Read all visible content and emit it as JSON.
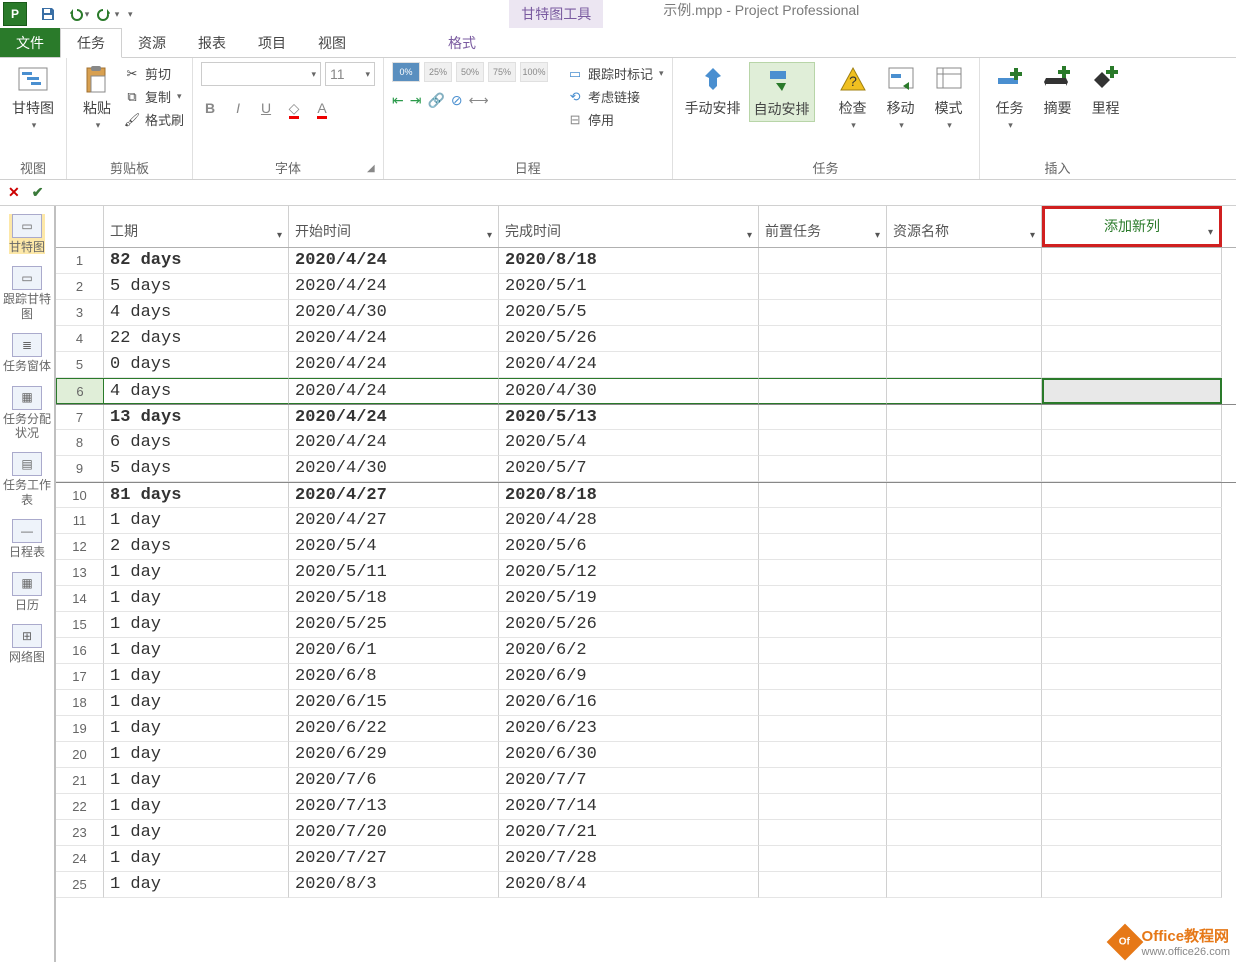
{
  "title": {
    "tool_context": "甘特图工具",
    "doc": "示例.mpp - Project Professional"
  },
  "tabs": {
    "file": "文件",
    "task": "任务",
    "resource": "资源",
    "report": "报表",
    "project": "项目",
    "view": "视图",
    "format": "格式"
  },
  "ribbon": {
    "view_group": "视图",
    "gantt_btn": "甘特图",
    "clipboard": {
      "label": "剪贴板",
      "paste": "粘贴",
      "cut": "剪切",
      "copy": "复制",
      "painter": "格式刷"
    },
    "font": {
      "label": "字体",
      "size": "11",
      "bold": "B",
      "italic": "I",
      "underline": "U"
    },
    "schedule": {
      "label": "日程",
      "p0": "0%",
      "p25": "25%",
      "p50": "50%",
      "p75": "75%",
      "p100": "100%",
      "track_mark": "跟踪时标记",
      "consider_link": "考虑链接",
      "deactivate": "停用"
    },
    "tasks": {
      "label": "任务",
      "manual": "手动安排",
      "auto": "自动安排",
      "inspect": "检查",
      "move": "移动",
      "mode": "模式"
    },
    "insert": {
      "label": "插入",
      "task": "任务",
      "summary": "摘要",
      "milestone": "里程"
    }
  },
  "side_views": {
    "gantt": "甘特图",
    "tracking": "跟踪甘特图",
    "task_form": "任务窗体",
    "usage": "任务分配状况",
    "task_sheet": "任务工作表",
    "timeline": "日程表",
    "calendar": "日历",
    "network": "网络图"
  },
  "columns": {
    "duration": "工期",
    "start": "开始时间",
    "finish": "完成时间",
    "predecessors": "前置任务",
    "resources": "资源名称",
    "new": "添加新列"
  },
  "rows": [
    {
      "n": 1,
      "dur": "82 days",
      "start": "2020/4/24",
      "end": "2020/8/18",
      "bold": true
    },
    {
      "n": 2,
      "dur": "5 days",
      "start": "2020/4/24",
      "end": "2020/5/1"
    },
    {
      "n": 3,
      "dur": "4 days",
      "start": "2020/4/30",
      "end": "2020/5/5"
    },
    {
      "n": 4,
      "dur": "22 days",
      "start": "2020/4/24",
      "end": "2020/5/26"
    },
    {
      "n": 5,
      "dur": "0 days",
      "start": "2020/4/24",
      "end": "2020/4/24"
    },
    {
      "n": 6,
      "dur": "4 days",
      "start": "2020/4/24",
      "end": "2020/4/30",
      "sel": true
    },
    {
      "n": 7,
      "dur": "13 days",
      "start": "2020/4/24",
      "end": "2020/5/13",
      "bold": true
    },
    {
      "n": 8,
      "dur": "6 days",
      "start": "2020/4/24",
      "end": "2020/5/4"
    },
    {
      "n": 9,
      "dur": "5 days",
      "start": "2020/4/30",
      "end": "2020/5/7"
    },
    {
      "n": 10,
      "dur": "81 days",
      "start": "2020/4/27",
      "end": "2020/8/18",
      "bold": true
    },
    {
      "n": 11,
      "dur": "1 day",
      "start": "2020/4/27",
      "end": "2020/4/28"
    },
    {
      "n": 12,
      "dur": "2 days",
      "start": "2020/5/4",
      "end": "2020/5/6"
    },
    {
      "n": 13,
      "dur": "1 day",
      "start": "2020/5/11",
      "end": "2020/5/12"
    },
    {
      "n": 14,
      "dur": "1 day",
      "start": "2020/5/18",
      "end": "2020/5/19"
    },
    {
      "n": 15,
      "dur": "1 day",
      "start": "2020/5/25",
      "end": "2020/5/26"
    },
    {
      "n": 16,
      "dur": "1 day",
      "start": "2020/6/1",
      "end": "2020/6/2"
    },
    {
      "n": 17,
      "dur": "1 day",
      "start": "2020/6/8",
      "end": "2020/6/9"
    },
    {
      "n": 18,
      "dur": "1 day",
      "start": "2020/6/15",
      "end": "2020/6/16"
    },
    {
      "n": 19,
      "dur": "1 day",
      "start": "2020/6/22",
      "end": "2020/6/23"
    },
    {
      "n": 20,
      "dur": "1 day",
      "start": "2020/6/29",
      "end": "2020/6/30"
    },
    {
      "n": 21,
      "dur": "1 day",
      "start": "2020/7/6",
      "end": "2020/7/7"
    },
    {
      "n": 22,
      "dur": "1 day",
      "start": "2020/7/13",
      "end": "2020/7/14"
    },
    {
      "n": 23,
      "dur": "1 day",
      "start": "2020/7/20",
      "end": "2020/7/21"
    },
    {
      "n": 24,
      "dur": "1 day",
      "start": "2020/7/27",
      "end": "2020/7/28"
    },
    {
      "n": 25,
      "dur": "1 day",
      "start": "2020/8/3",
      "end": "2020/8/4"
    }
  ],
  "watermark": {
    "brand": "Office教程网",
    "url": "www.office26.com"
  }
}
